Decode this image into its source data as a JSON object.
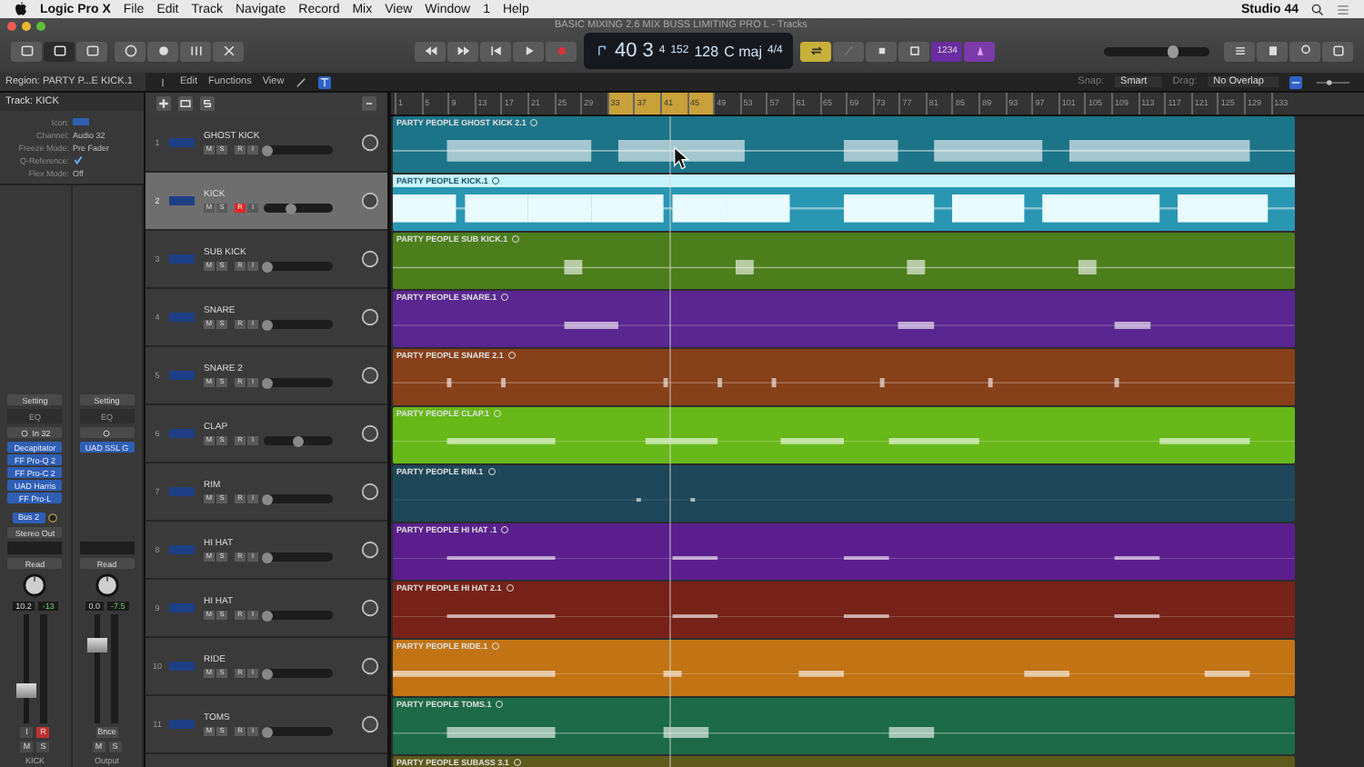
{
  "menu_bar": {
    "app": "Logic Pro X",
    "items": [
      "File",
      "Edit",
      "Track",
      "Navigate",
      "Record",
      "Mix",
      "View",
      "Window",
      "1",
      "Help"
    ],
    "user": "Studio 44"
  },
  "window": {
    "title": "BASIC MIXING 2.6 MIX BUSS LIMITING PRO L - Tracks"
  },
  "toolbar": {
    "view_buttons": [
      {
        "selected": false
      },
      {
        "selected": true
      },
      {
        "selected": false
      }
    ],
    "cycle_on": true,
    "count_in": "1234",
    "master_volume": {
      "level": 0.65
    }
  },
  "lcd": {
    "bar": "40",
    "beat": "3",
    "division": "4",
    "tick": "152",
    "tempo": "128",
    "key": "C maj",
    "signature": "4/4"
  },
  "control_bar": {
    "region": "Region: PARTY P...E KICK.1",
    "menus": [
      "Edit",
      "Functions",
      "View"
    ],
    "snap_label": "Snap:",
    "snap": "Smart",
    "drag_label": "Drag:",
    "drag": "No Overlap"
  },
  "inspector": {
    "track": "Track: KICK",
    "fields": [
      {
        "label": "Icon:",
        "kind": "icon"
      },
      {
        "label": "Channel:",
        "kind": "popup",
        "value": "Audio 32"
      },
      {
        "label": "Freeze Mode:",
        "kind": "popup",
        "value": "Pre Fader"
      },
      {
        "label": "Q-Reference:",
        "kind": "check",
        "checked": true
      },
      {
        "label": "Flex Mode:",
        "kind": "popup",
        "value": "Off"
      }
    ]
  },
  "strips": [
    {
      "setting": "Setting",
      "eq": "EQ",
      "input": "In 32",
      "plugins": [
        "Decapitator",
        "FF Pro-Q 2",
        "FF Pro-C 2",
        "UAD Harris",
        "FF Pro-L"
      ],
      "sends": [
        "Bus 2"
      ],
      "output": "Stereo Out",
      "automation": "Read",
      "volume": "10.2",
      "peak": "-13",
      "level": 0.3,
      "buttons": [
        {
          "label": "I",
          "on": false
        },
        {
          "label": "R",
          "on": true
        }
      ],
      "mute": "M",
      "solo": "S",
      "name": "KICK"
    },
    {
      "setting": "Setting",
      "eq": "EQ",
      "plugins": [
        "UAD SSL G"
      ],
      "automation": "Read",
      "volume": "0.0",
      "peak": "-7.5",
      "level": 0.72,
      "buttons": [
        {
          "label": "Bnce",
          "on": false
        }
      ],
      "mute": "M",
      "solo": "S",
      "name": "Output"
    }
  ],
  "ruler": [
    {
      "label": "1",
      "in_cycle": false
    },
    {
      "label": "5",
      "in_cycle": false
    },
    {
      "label": "9",
      "in_cycle": false
    },
    {
      "label": "13",
      "in_cycle": false
    },
    {
      "label": "17",
      "in_cycle": false
    },
    {
      "label": "21",
      "in_cycle": false
    },
    {
      "label": "25",
      "in_cycle": false
    },
    {
      "label": "29",
      "in_cycle": false
    },
    {
      "label": "33",
      "in_cycle": true
    },
    {
      "label": "37",
      "in_cycle": true
    },
    {
      "label": "41",
      "in_cycle": true
    },
    {
      "label": "45",
      "in_cycle": true
    },
    {
      "label": "49",
      "in_cycle": false
    },
    {
      "label": "53",
      "in_cycle": false
    },
    {
      "label": "57",
      "in_cycle": false
    },
    {
      "label": "61",
      "in_cycle": false
    },
    {
      "label": "65",
      "in_cycle": false
    },
    {
      "label": "69",
      "in_cycle": false
    },
    {
      "label": "73",
      "in_cycle": false
    },
    {
      "label": "77",
      "in_cycle": false
    },
    {
      "label": "81",
      "in_cycle": false
    },
    {
      "label": "85",
      "in_cycle": false
    },
    {
      "label": "89",
      "in_cycle": false
    },
    {
      "label": "93",
      "in_cycle": false
    },
    {
      "label": "97",
      "in_cycle": false
    },
    {
      "label": "101",
      "in_cycle": false
    },
    {
      "label": "105",
      "in_cycle": false
    },
    {
      "label": "109",
      "in_cycle": false
    },
    {
      "label": "113",
      "in_cycle": false
    },
    {
      "label": "117",
      "in_cycle": false
    },
    {
      "label": "121",
      "in_cycle": false
    },
    {
      "label": "125",
      "in_cycle": false
    },
    {
      "label": "129",
      "in_cycle": false
    },
    {
      "label": "133",
      "in_cycle": false
    }
  ],
  "tracks": [
    {
      "number": "1",
      "name": "GHOST KICK",
      "selected": false,
      "buttons": [
        "M",
        "S",
        "R",
        "I"
      ],
      "record_armed": false,
      "level": 0.05,
      "region": {
        "name": "PARTY PEOPLE GHOST KICK 2.1",
        "color": "#1c7488",
        "selected": false
      }
    },
    {
      "number": "2",
      "name": "KICK",
      "selected": true,
      "buttons": [
        "M",
        "S",
        "R",
        "I"
      ],
      "record_armed": true,
      "level": 0.4,
      "region": {
        "name": "PARTY PEOPLE KICK.1",
        "color": "#2996b2",
        "selected": true
      }
    },
    {
      "number": "3",
      "name": "SUB KICK",
      "selected": false,
      "buttons": [
        "M",
        "S",
        "R",
        "I"
      ],
      "record_armed": false,
      "level": 0.05,
      "region": {
        "name": "PARTY PEOPLE SUB KICK.1",
        "color": "#4c7e1c",
        "selected": false
      }
    },
    {
      "number": "4",
      "name": "SNARE",
      "selected": false,
      "buttons": [
        "M",
        "S",
        "R",
        "I"
      ],
      "record_armed": false,
      "level": 0.05,
      "region": {
        "name": "PARTY PEOPLE SNARE.1",
        "color": "#5a2690",
        "selected": false
      }
    },
    {
      "number": "5",
      "name": "SNARE 2",
      "selected": false,
      "buttons": [
        "M",
        "S",
        "R",
        "I"
      ],
      "record_armed": false,
      "level": 0.05,
      "region": {
        "name": "PARTY PEOPLE SNARE 2.1",
        "color": "#86401a",
        "selected": false
      }
    },
    {
      "number": "6",
      "name": "CLAP",
      "selected": false,
      "buttons": [
        "M",
        "S",
        "R",
        "I"
      ],
      "record_armed": false,
      "level": 0.5,
      "region": {
        "name": "PARTY PEOPLE CLAP.1",
        "color": "#68b81a",
        "selected": false
      }
    },
    {
      "number": "7",
      "name": "RIM",
      "selected": false,
      "buttons": [
        "M",
        "S",
        "R",
        "I"
      ],
      "record_armed": false,
      "level": 0.05,
      "region": {
        "name": "PARTY PEOPLE  RIM.1",
        "color": "#1d4658",
        "selected": false
      }
    },
    {
      "number": "8",
      "name": "HI HAT",
      "selected": false,
      "buttons": [
        "M",
        "S",
        "R",
        "I"
      ],
      "record_armed": false,
      "level": 0.05,
      "region": {
        "name": "PARTY PEOPLE HI HAT .1",
        "color": "#5a1f8c",
        "selected": false
      }
    },
    {
      "number": "9",
      "name": "HI HAT",
      "selected": false,
      "buttons": [
        "M",
        "S",
        "R",
        "I"
      ],
      "record_armed": false,
      "level": 0.05,
      "region": {
        "name": "PARTY PEOPLE HI HAT 2.1",
        "color": "#762218",
        "selected": false
      }
    },
    {
      "number": "10",
      "name": "RIDE",
      "selected": false,
      "buttons": [
        "M",
        "S",
        "R",
        "I"
      ],
      "record_armed": false,
      "level": 0.05,
      "region": {
        "name": "PARTY PEOPLE RIDE.1",
        "color": "#c27414",
        "selected": false
      }
    },
    {
      "number": "11",
      "name": "TOMS",
      "selected": false,
      "buttons": [
        "M",
        "S",
        "R",
        "I"
      ],
      "record_armed": false,
      "level": 0.05,
      "region": {
        "name": "PARTY PEOPLE  TOMS.1",
        "color": "#1c6a48",
        "selected": false
      }
    },
    {
      "region": {
        "name": "PARTY PEOPLE  SUBASS 3.1",
        "color": "#5e5a1c",
        "selected": false
      }
    }
  ]
}
